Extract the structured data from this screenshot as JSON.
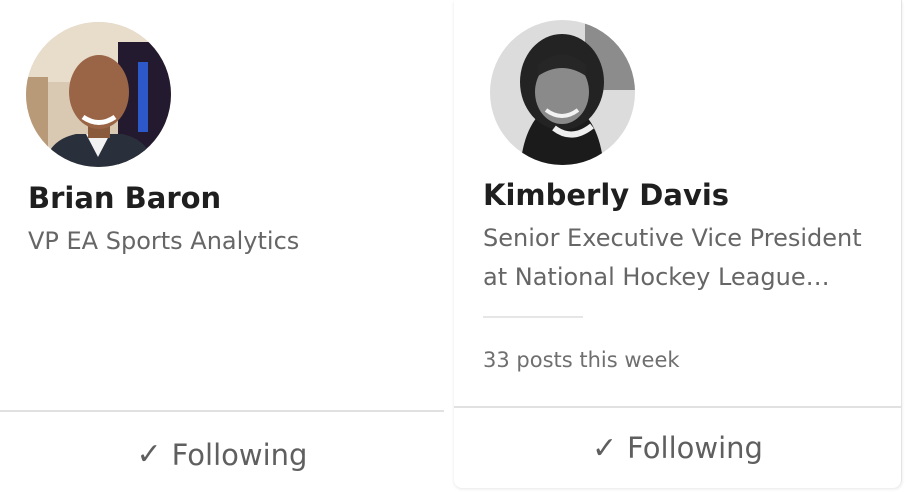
{
  "cards": [
    {
      "name": "Brian Baron",
      "headline": "VP EA Sports Analytics",
      "follow_label": "Following",
      "check_glyph": "✓"
    },
    {
      "name": "Kimberly Davis",
      "headline": "Senior Executive Vice President at National Hockey League…",
      "activity": "33 posts this week",
      "follow_label": "Following",
      "check_glyph": "✓"
    }
  ],
  "icons": {
    "follow_state": "checkmark-icon"
  },
  "colors": {
    "name": "#1f1f1f",
    "secondary": "#666666",
    "button_text": "#5f5f5f",
    "divider": "#e1e1e1"
  }
}
